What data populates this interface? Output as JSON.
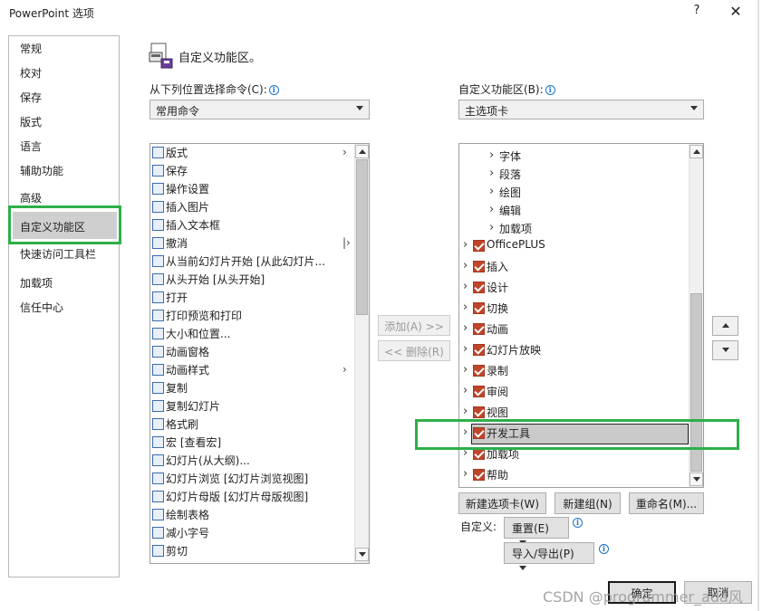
{
  "window": {
    "title": "PowerPoint 选项",
    "help": "?",
    "close": "✕"
  },
  "nav": {
    "items": [
      "常规",
      "校对",
      "保存",
      "版式",
      "语言",
      "辅助功能",
      "高级",
      "自定义功能区",
      "快速访问工具栏",
      "加载项",
      "信任中心"
    ],
    "selected_index": 7
  },
  "header": {
    "title": "自定义功能区。"
  },
  "left": {
    "label": "从下列位置选择命令(C):",
    "combo_value": "常用命令",
    "items": [
      {
        "label": "版式",
        "icon": "layout-icon",
        "submenu": true
      },
      {
        "label": "保存",
        "icon": "save-icon"
      },
      {
        "label": "操作设置",
        "icon": "action-settings-icon"
      },
      {
        "label": "插入图片",
        "icon": "insert-picture-icon"
      },
      {
        "label": "插入文本框",
        "icon": "insert-textbox-icon"
      },
      {
        "label": "撤消",
        "icon": "undo-icon",
        "split": true
      },
      {
        "label": "从当前幻灯片开始 [从此幻灯片...",
        "icon": "from-current-slide-icon"
      },
      {
        "label": "从头开始 [从头开始]",
        "icon": "from-beginning-icon"
      },
      {
        "label": "打开",
        "icon": "open-folder-icon"
      },
      {
        "label": "打印预览和打印",
        "icon": "print-preview-icon"
      },
      {
        "label": "大小和位置...",
        "icon": "size-position-icon"
      },
      {
        "label": "动画窗格",
        "icon": "animation-pane-icon"
      },
      {
        "label": "动画样式",
        "icon": "animation-styles-icon",
        "submenu": true
      },
      {
        "label": "复制",
        "icon": "copy-icon"
      },
      {
        "label": "复制幻灯片",
        "icon": "duplicate-slide-icon"
      },
      {
        "label": "格式刷",
        "icon": "format-painter-icon"
      },
      {
        "label": "宏 [查看宏]",
        "icon": "macro-icon"
      },
      {
        "label": "幻灯片(从大纲)...",
        "icon": "slides-from-outline-icon"
      },
      {
        "label": "幻灯片浏览 [幻灯片浏览视图]",
        "icon": "slide-sorter-icon"
      },
      {
        "label": "幻灯片母版 [幻灯片母版视图]",
        "icon": "slide-master-icon"
      },
      {
        "label": "绘制表格",
        "icon": "draw-table-icon"
      },
      {
        "label": "减小字号",
        "icon": "decrease-font-icon"
      },
      {
        "label": "剪切",
        "icon": "cut-icon"
      }
    ]
  },
  "middle": {
    "add": "添加(A) >>",
    "remove": "<< 删除(R)"
  },
  "right": {
    "label": "自定义功能区(B):",
    "combo_value": "主选项卡",
    "groups": [
      "字体",
      "段落",
      "绘图",
      "编辑",
      "加载项"
    ],
    "tabs": [
      "OfficePLUS",
      "插入",
      "设计",
      "切换",
      "动画",
      "幻灯片放映",
      "录制",
      "审阅",
      "视图",
      "开发工具",
      "加载项",
      "帮助"
    ],
    "selected_tab": "开发工具"
  },
  "buttons": {
    "new_tab": "新建选项卡(W)",
    "new_group": "新建组(N)",
    "rename": "重命名(M)...",
    "customize_label": "自定义:",
    "reset": "重置(E)",
    "import_export": "导入/导出(P)",
    "ok": "确定",
    "cancel": "取消"
  },
  "watermark": "CSDN @programmer_ada风"
}
